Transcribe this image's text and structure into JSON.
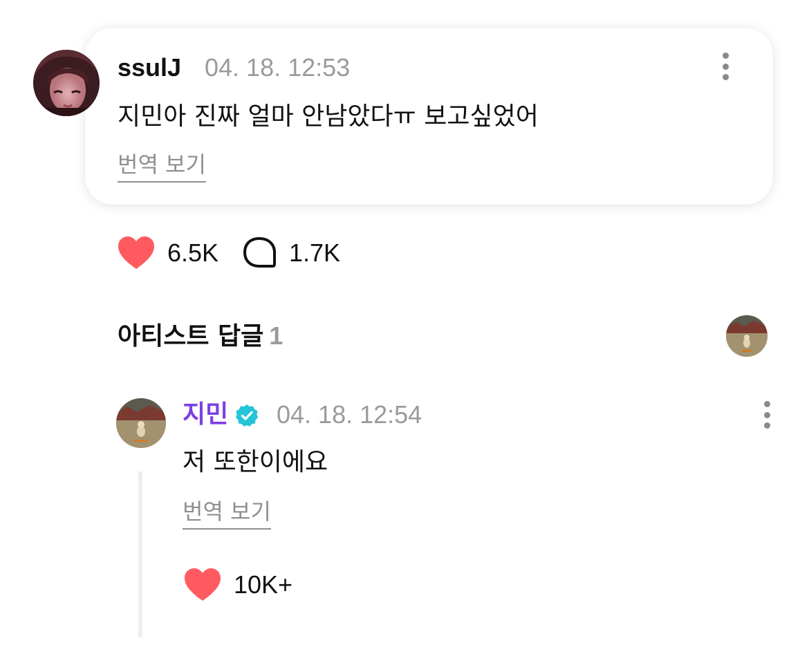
{
  "comment": {
    "author": "ssulJ",
    "timestamp": "04. 18. 12:53",
    "text": "지민아 진짜 얼마 안남았다ㅠ 보고싶었어",
    "translate_label": "번역 보기",
    "likes": "6.5K",
    "replies": "1.7K"
  },
  "artist_replies": {
    "title": "아티스트 답글",
    "count": "1"
  },
  "reply": {
    "author": "지민",
    "timestamp": "04. 18. 12:54",
    "text": "저 또한이에요",
    "translate_label": "번역 보기",
    "likes": "10K+"
  },
  "icons": {
    "like": "heart-icon",
    "comment": "speech-bubble-icon",
    "more": "more-vertical-icon",
    "verified": "verified-badge-icon"
  },
  "colors": {
    "heart": "#ff5a5f",
    "artist_name": "#7b3fe4",
    "verified_badge": "#25c4d8",
    "muted_text": "#9a9a9a"
  }
}
